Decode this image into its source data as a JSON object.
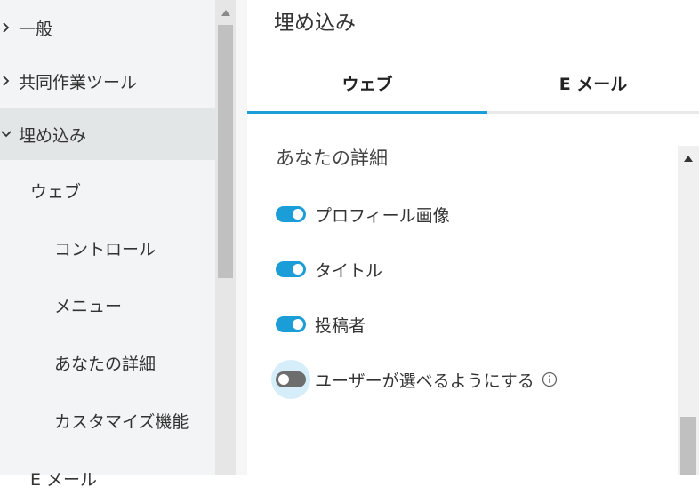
{
  "sidebar": {
    "items": [
      {
        "label": "一般",
        "chevron": "chevron-right"
      },
      {
        "label": "共同作業ツール",
        "chevron": "chevron-right"
      },
      {
        "label": "埋め込み",
        "chevron": "chevron-down",
        "active": true
      },
      {
        "label": "ウェブ"
      },
      {
        "label": "コントロール"
      },
      {
        "label": "メニュー"
      },
      {
        "label": "あなたの詳細"
      },
      {
        "label": "カスタマイズ機能"
      },
      {
        "label": "E メール"
      }
    ]
  },
  "main": {
    "title": "埋め込み",
    "tabs": [
      {
        "label": "ウェブ",
        "active": true
      },
      {
        "label": "E メール",
        "active": false
      }
    ],
    "section_title": "あなたの詳細",
    "options": [
      {
        "label": "プロフィール画像",
        "enabled": true
      },
      {
        "label": "タイトル",
        "enabled": true
      },
      {
        "label": "投稿者",
        "enabled": true
      },
      {
        "label": "ユーザーが選べるようにする",
        "enabled": false,
        "icon": "info-icon"
      }
    ]
  },
  "colors": {
    "accent": "#1b9dd8",
    "sidebar_bg": "#f3f4f5",
    "sidebar_active_bg": "#e3e6e7",
    "toggle_off": "#6d6d6d"
  }
}
